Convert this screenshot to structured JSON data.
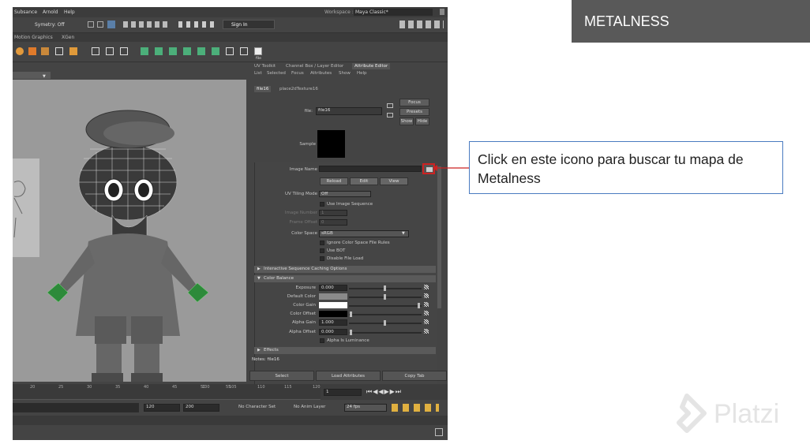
{
  "slide": {
    "heading": "METALNESS",
    "callout": "Click en este icono para buscar tu mapa de Metalness",
    "logo": "Platzi"
  },
  "maya": {
    "menu": [
      "Subsance",
      "Arnold",
      "Help"
    ],
    "workspace_label": "Workspace :",
    "workspace_value": "Maya Classic*",
    "symmetry": "Symetry: Off",
    "sign_in": "Sign In",
    "shelf_tabs": [
      "Motion Graphics",
      "XGen"
    ],
    "shelf_file_label": "file",
    "panel_tabs": [
      "UV Toolkit",
      "Channel Box / Layer Editor",
      "Attribute Editor"
    ],
    "attr_menu": [
      "List",
      "Selected",
      "Focus",
      "Attributes",
      "Show",
      "Help"
    ],
    "node_tabs": [
      "file16",
      "place2dTexture16"
    ],
    "file_label": "file:",
    "file_value": "file16",
    "focus": "Focus",
    "presets": "Presets",
    "show": "Show",
    "hide": "Hide",
    "sample": "Sample",
    "image_name": "Image Name",
    "reload": "Reload",
    "edit": "Edit",
    "view": "View",
    "uv_tiling_label": "UV Tiling Mode",
    "uv_tiling_value": "Off",
    "use_sequence": "Use Image Sequence",
    "image_number": "Image Number",
    "image_number_value": "1",
    "frame_offset": "Frame Offset",
    "frame_offset_value": "0",
    "color_space_label": "Color Space",
    "color_space_value": "sRGB",
    "ignore_rules": "Ignore Color Space File Rules",
    "use_bot": "Use BOT",
    "disable_load": "Disable File Load",
    "section_caching": "Interactive Sequence Caching Options",
    "section_balance": "Color Balance",
    "exposure_label": "Exposure",
    "exposure_value": "0.000",
    "default_color": "Default Color",
    "color_gain": "Color Gain",
    "color_offset": "Color Offset",
    "alpha_gain_label": "Alpha Gain",
    "alpha_gain_value": "1.000",
    "alpha_offset_label": "Alpha Offset",
    "alpha_offset_value": "0.000",
    "alpha_lum": "Alpha Is Luminance",
    "section_effects": "Effects",
    "notes": "Notes: file16",
    "select_btn": "Select",
    "load_attr_btn": "Load Attributes",
    "copy_tab_btn": "Copy Tab",
    "timeline_ticks": [
      "20",
      "25",
      "30",
      "35",
      "40",
      "45",
      "50",
      "55",
      "100",
      "105",
      "110",
      "115",
      "120"
    ],
    "current_frame": "1",
    "range_end": "120",
    "range_max": "200",
    "character_set": "No Character Set",
    "anim_layer": "No Anim Layer",
    "fps": "24 fps"
  },
  "colors": {
    "heading_bg": "#595959",
    "callout_border": "#4a7bc0",
    "highlight": "#cc2222"
  }
}
